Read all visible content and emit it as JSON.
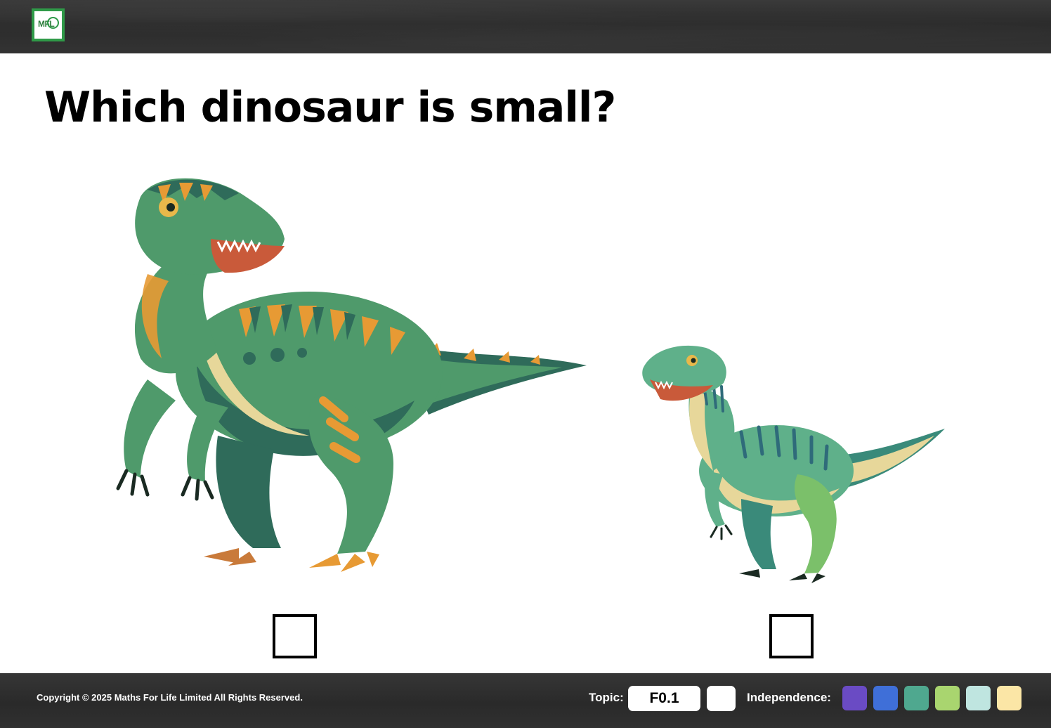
{
  "header": {
    "logo_text": "MFL"
  },
  "question": "Which dinosaur is small?",
  "options": [
    {
      "name": "large dinosaur",
      "checked": false
    },
    {
      "name": "small dinosaur",
      "checked": false
    }
  ],
  "footer": {
    "copyright": "Copyright © 2025 Maths For Life Limited All Rights Reserved.",
    "topic_label": "Topic:",
    "topic_value": "F0.1",
    "independence_label": "Independence:",
    "independence_colors": [
      "#6a4bc4",
      "#3f6fd8",
      "#4fa88f",
      "#a9d56f",
      "#bfe5e0",
      "#fbe6a6"
    ]
  },
  "colors": {
    "dino_dark": "#2f6b5a",
    "dino_green": "#4f9a6b",
    "dino_orange": "#e79a34",
    "dino_belly": "#e7d79a",
    "logo_green": "#2f9a48"
  }
}
